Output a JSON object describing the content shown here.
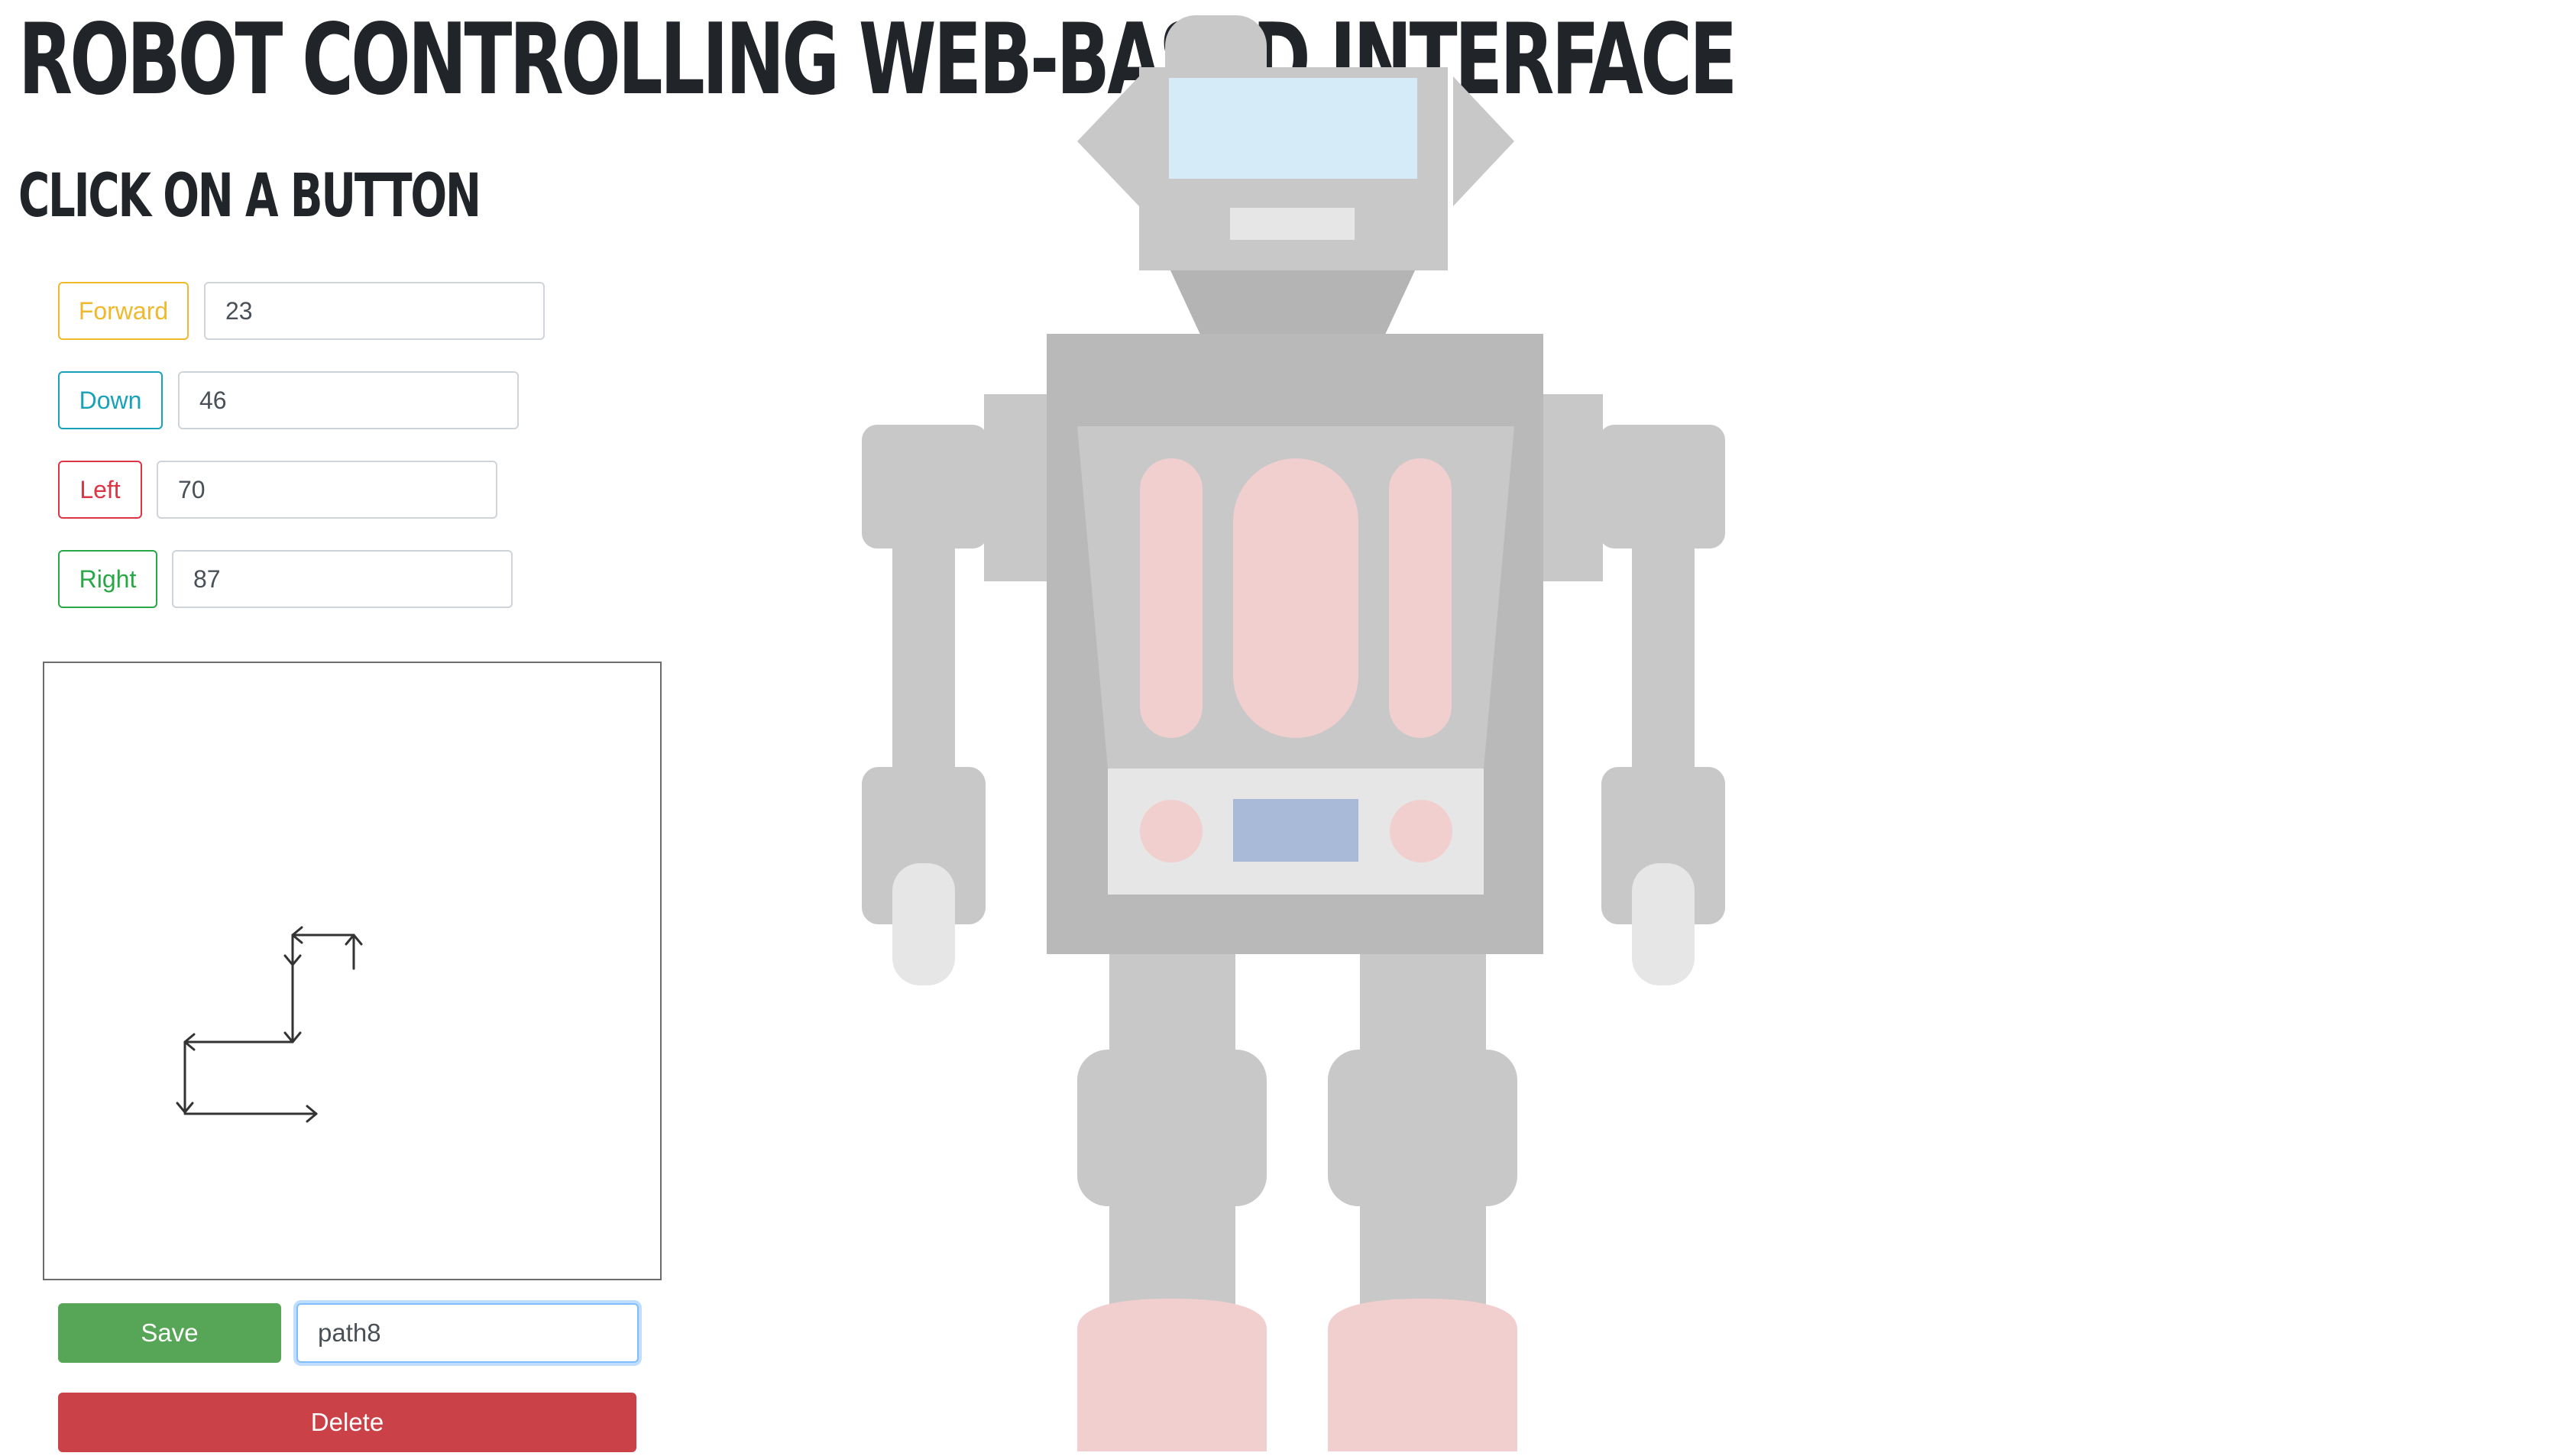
{
  "header": {
    "title": "Robot Controlling Web-Based Interface",
    "subtitle": "Click on a button"
  },
  "controls": [
    {
      "label": "Forward",
      "value": "23",
      "color": "#f0b82d"
    },
    {
      "label": "Down",
      "value": "46",
      "color": "#17a2b8"
    },
    {
      "label": "Left",
      "value": "70",
      "color": "#dc3545"
    },
    {
      "label": "Right",
      "value": "87",
      "color": "#28a745"
    }
  ],
  "path_preview": {
    "arrow_color": "#333333",
    "segments": [
      "up",
      "left",
      "down",
      "left",
      "down",
      "right"
    ]
  },
  "actions": {
    "save_label": "Save",
    "path_name_value": "path8",
    "delete_label": "Delete",
    "save_color": "#57a556",
    "delete_color": "#cb4148"
  },
  "robot": {
    "description_icon": "robot-illustration",
    "body_color": "#c8c8c8",
    "accent_color": "#f2cfcf",
    "screen_color": "#d6ebf8",
    "panel_color": "#a9b9d8"
  }
}
